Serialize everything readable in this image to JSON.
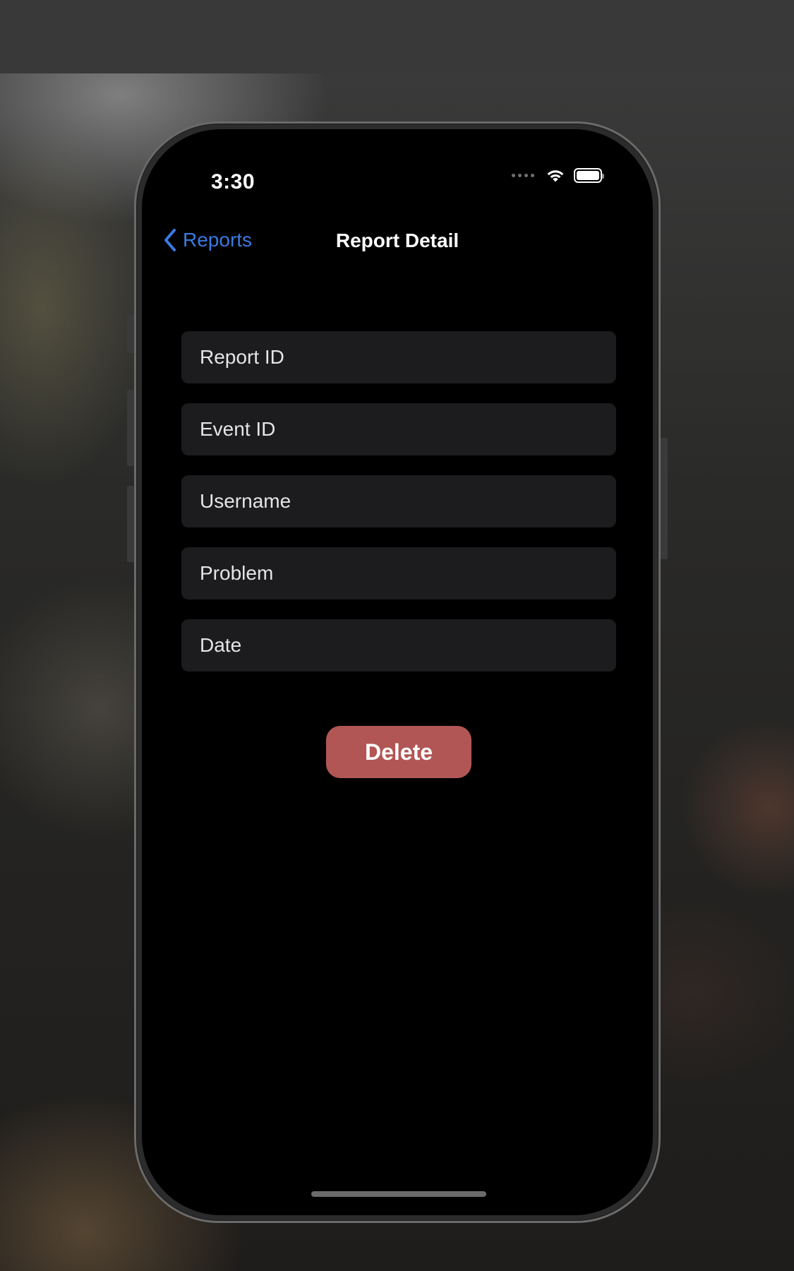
{
  "status_bar": {
    "time": "3:30",
    "icons": [
      "cellular-signal-icon",
      "wifi-icon",
      "battery-icon"
    ]
  },
  "nav": {
    "back_label": "Reports",
    "title": "Report Detail"
  },
  "form": {
    "fields": [
      {
        "placeholder": "Report ID",
        "value": ""
      },
      {
        "placeholder": "Event ID",
        "value": ""
      },
      {
        "placeholder": "Username",
        "value": ""
      },
      {
        "placeholder": "Problem",
        "value": ""
      },
      {
        "placeholder": "Date",
        "value": ""
      }
    ]
  },
  "actions": {
    "delete_label": "Delete"
  },
  "colors": {
    "accent": "#3b7ae3",
    "destructive": "#b25655",
    "field_background": "#1c1c1e",
    "screen_background": "#000000"
  }
}
